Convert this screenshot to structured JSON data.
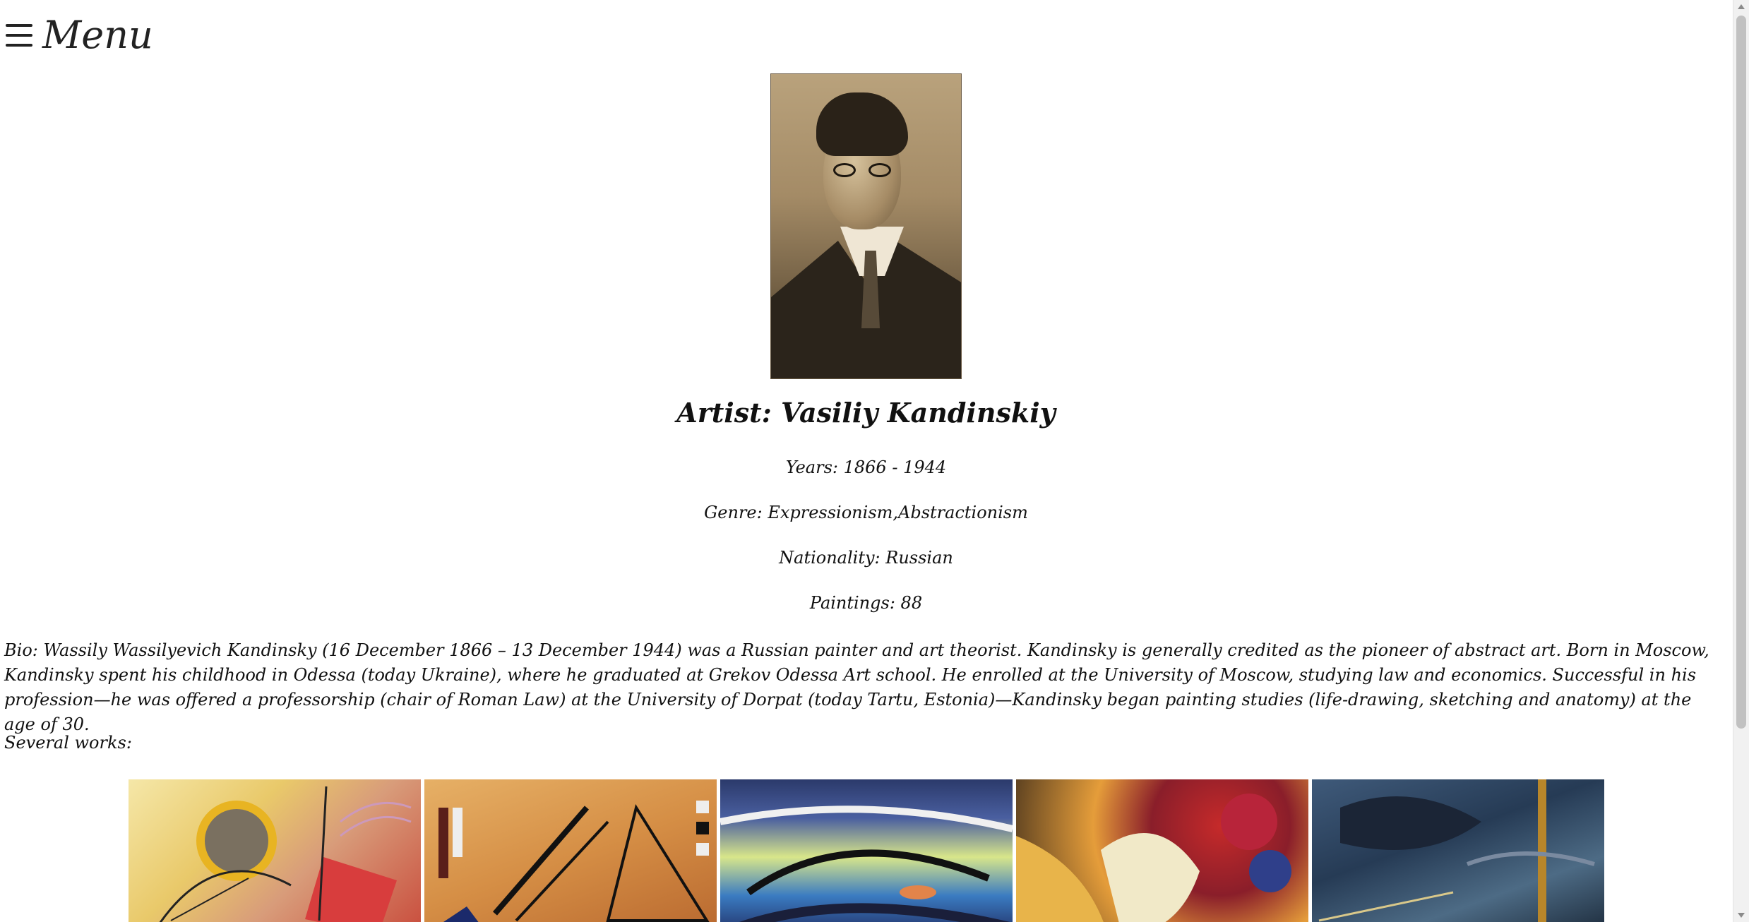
{
  "nav": {
    "menu_icon": "hamburger-icon",
    "menu_label": "Menu"
  },
  "artist": {
    "portrait_alt": "Vasiliy Kandinskiy portrait",
    "name_line": "Artist: Vasiliy Kandinskiy",
    "years_line": "Years: 1866 - 1944",
    "genre_line": "Genre: Expressionism,Abstractionism",
    "nationality_line": "Nationality: Russian",
    "paintings_line": "Paintings: 88",
    "bio": "Bio: Wassily Wassilyevich Kandinsky (16 December 1866 – 13 December 1944) was a Russian painter and art theorist. Kandinsky is generally credited as the pioneer of abstract art. Born in Moscow, Kandinsky spent his childhood in Odessa (today Ukraine), where he graduated at Grekov Odessa Art school. He enrolled at the University of Moscow, studying law and economics. Successful in his profession—he was offered a professorship (chair of Roman Law) at the University of Dorpat (today Tartu, Estonia)—Kandinsky began painting studies (life-drawing, sketching and anatomy) at the age of 30."
  },
  "works": {
    "label": "Several works:",
    "items": [
      {
        "name": "work-1"
      },
      {
        "name": "work-2"
      },
      {
        "name": "work-3"
      },
      {
        "name": "work-4"
      },
      {
        "name": "work-5"
      }
    ]
  }
}
